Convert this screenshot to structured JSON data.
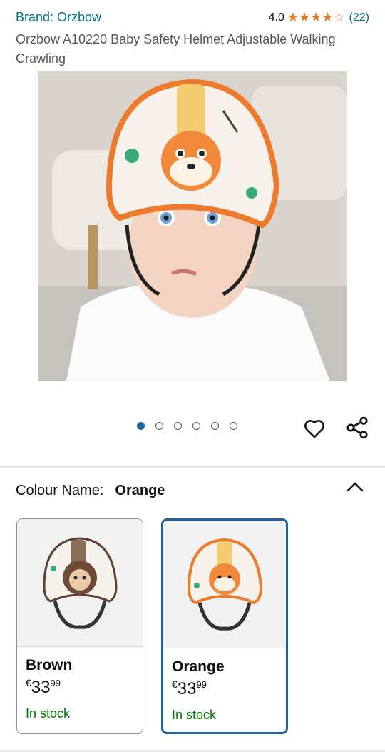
{
  "header": {
    "brand": "Brand: Orzbow",
    "rating_value": "4.0",
    "rating_stars": 4,
    "rating_count": "(22)",
    "title": "Orzbow A10220 Baby Safety Helmet Adjustable Walking Crawling"
  },
  "gallery": {
    "image_count": 6,
    "active_index": 0,
    "wishlist_icon": "heart-outline-icon",
    "share_icon": "share-icon"
  },
  "variant": {
    "label": "Colour Name:",
    "selected": "Orange",
    "options": [
      {
        "name": "Brown",
        "currency": "€",
        "price_whole": "33",
        "price_frac": "99",
        "stock": "In stock"
      },
      {
        "name": "Orange",
        "currency": "€",
        "price_whole": "33",
        "price_frac": "99",
        "stock": "In stock"
      }
    ]
  },
  "colors": {
    "link": "#007185",
    "accent": "#2162a1",
    "stock": "#007600",
    "star": "#de7921"
  }
}
